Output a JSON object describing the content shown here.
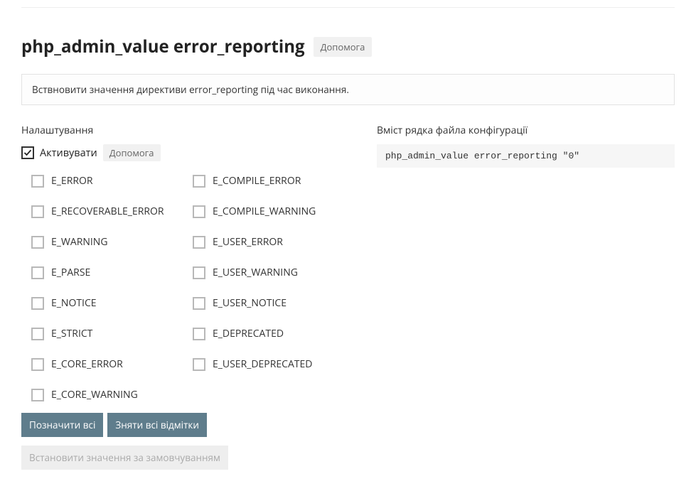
{
  "title": "php_admin_value error_reporting",
  "help_label": "Допомога",
  "description": "Вствновити значення директиви error_reporting під час виконання.",
  "settings_label": "Налаштування",
  "activate_label": "Активувати",
  "activate_checked": true,
  "options_col1": [
    "E_ERROR",
    "E_RECOVERABLE_ERROR",
    "E_WARNING",
    "E_PARSE",
    "E_NOTICE",
    "E_STRICT",
    "E_CORE_ERROR",
    "E_CORE_WARNING"
  ],
  "options_col2": [
    "E_COMPILE_ERROR",
    "E_COMPILE_WARNING",
    "E_USER_ERROR",
    "E_USER_WARNING",
    "E_USER_NOTICE",
    "E_DEPRECATED",
    "E_USER_DEPRECATED"
  ],
  "btn_select_all": "Позначити всі",
  "btn_deselect_all": "Зняти всі відмітки",
  "btn_reset_default": "Встановити значення за замовчуванням",
  "config_label": "Вміст рядка файла конфігурації",
  "config_value": "php_admin_value error_reporting \"0\""
}
